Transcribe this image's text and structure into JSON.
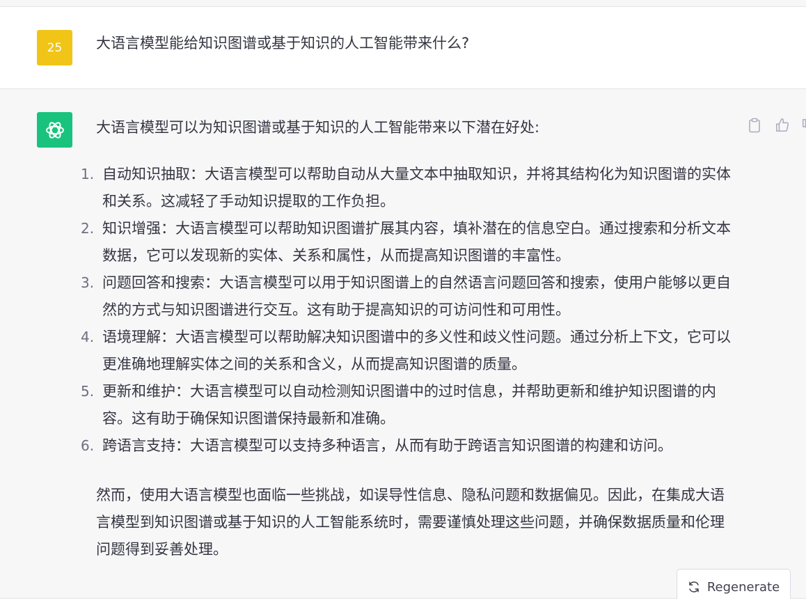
{
  "user_message": {
    "avatar_label": "25",
    "text": "大语言模型能给知识图谱或基于知识的人工智能带来什么?"
  },
  "assistant_message": {
    "intro": "大语言模型可以为知识图谱或基于知识的人工智能带来以下潜在好处:",
    "points": [
      {
        "num": "1.",
        "text": "自动知识抽取：大语言模型可以帮助自动从大量文本中抽取知识，并将其结构化为知识图谱的实体和关系。这减轻了手动知识提取的工作负担。"
      },
      {
        "num": "2.",
        "text": "知识增强：大语言模型可以帮助知识图谱扩展其内容，填补潜在的信息空白。通过搜索和分析文本数据，它可以发现新的实体、关系和属性，从而提高知识图谱的丰富性。"
      },
      {
        "num": "3.",
        "text": "问题回答和搜索：大语言模型可以用于知识图谱上的自然语言问题回答和搜索，使用户能够以更自然的方式与知识图谱进行交互。这有助于提高知识的可访问性和可用性。"
      },
      {
        "num": "4.",
        "text": "语境理解：大语言模型可以帮助解决知识图谱中的多义性和歧义性问题。通过分析上下文，它可以更准确地理解实体之间的关系和含义，从而提高知识图谱的质量。"
      },
      {
        "num": "5.",
        "text": "更新和维护：大语言模型可以自动检测知识图谱中的过时信息，并帮助更新和维护知识图谱的内容。这有助于确保知识图谱保持最新和准确。"
      },
      {
        "num": "6.",
        "text": "跨语言支持：大语言模型可以支持多种语言，从而有助于跨语言知识图谱的构建和访问。"
      }
    ],
    "conclusion": "然而，使用大语言模型也面临一些挑战，如误导性信息、隐私问题和数据偏见。因此，在集成大语言模型到知识图谱或基于知识的人工智能系统时，需要谨慎处理这些问题，并确保数据质量和伦理问题得到妥善处理。"
  },
  "actions": {
    "copy_icon": "clipboard-icon",
    "like_icon": "thumbs-up-icon",
    "dislike_icon": "thumbs-down-icon"
  },
  "regenerate": {
    "label": "Regenerate",
    "icon": "refresh-icon"
  },
  "colors": {
    "user_avatar": "#f0c518",
    "bot_avatar": "#19c37d",
    "assistant_bg": "#f7f7f8"
  }
}
